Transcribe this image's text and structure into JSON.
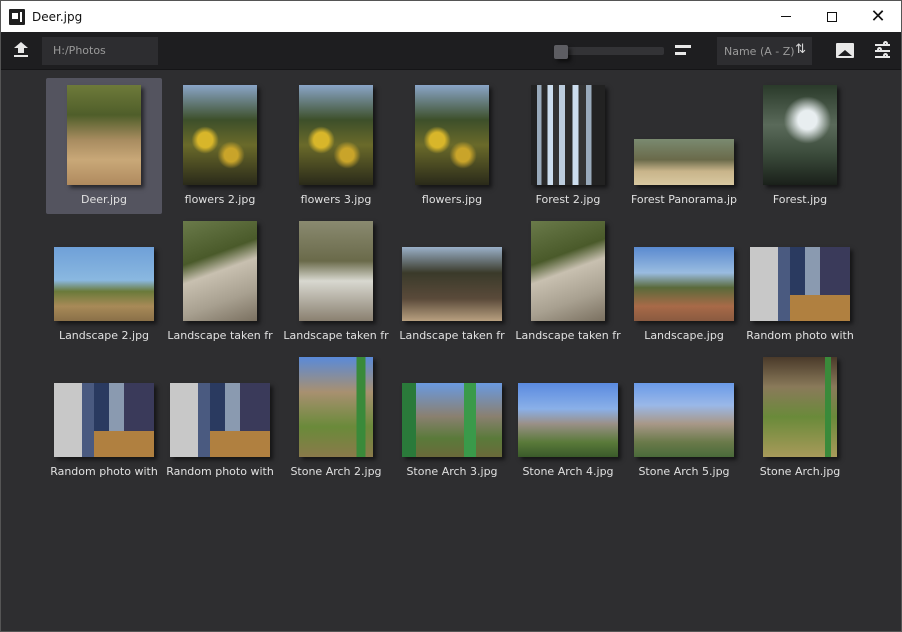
{
  "window": {
    "title": "Deer.jpg",
    "controls": {
      "minimize": "minimize",
      "maximize": "maximize",
      "close": "✕"
    }
  },
  "toolbar": {
    "upload_icon": "upload-icon",
    "path_value": "H:/Photos",
    "zoom_level": 0,
    "view_icon": "list-view-icon",
    "sort_label": "Name (A - Z)",
    "sort_direction_icon": "⇅",
    "image_icon": "image-icon",
    "settings_icon": "sliders-icon"
  },
  "gallery": {
    "selected_index": 0,
    "items": [
      {
        "name": "Deer.jpg",
        "art": "p-deer",
        "orientation": "portrait"
      },
      {
        "name": "flowers 2.jpg",
        "art": "p-flowers",
        "orientation": "portrait"
      },
      {
        "name": "flowers 3.jpg",
        "art": "p-flowers",
        "orientation": "portrait"
      },
      {
        "name": "flowers.jpg",
        "art": "p-flowers",
        "orientation": "portrait"
      },
      {
        "name": "Forest 2.jpg",
        "art": "p-forest2",
        "orientation": "portrait"
      },
      {
        "name": "Forest Panorama.jp",
        "art": "p-panorama",
        "orientation": "panorama"
      },
      {
        "name": "Forest.jpg",
        "art": "p-forest",
        "orientation": "portrait"
      },
      {
        "name": "Landscape 2.jpg",
        "art": "p-land2",
        "orientation": "landscape"
      },
      {
        "name": "Landscape taken fr",
        "art": "p-wall",
        "orientation": "portrait"
      },
      {
        "name": "Landscape taken fr",
        "art": "p-wall2",
        "orientation": "portrait"
      },
      {
        "name": "Landscape taken fr",
        "art": "p-trees",
        "orientation": "landscape"
      },
      {
        "name": "Landscape taken fr",
        "art": "p-wall",
        "orientation": "portrait"
      },
      {
        "name": "Landscape.jpg",
        "art": "p-land",
        "orientation": "landscape"
      },
      {
        "name": "Random photo with",
        "art": "p-random",
        "orientation": "landscape"
      },
      {
        "name": "Random photo with",
        "art": "p-random",
        "orientation": "landscape"
      },
      {
        "name": "Random photo with",
        "art": "p-random",
        "orientation": "landscape"
      },
      {
        "name": "Stone Arch 2.jpg",
        "art": "p-arch2",
        "orientation": "portrait"
      },
      {
        "name": "Stone Arch 3.jpg",
        "art": "p-arch3",
        "orientation": "landscape"
      },
      {
        "name": "Stone Arch 4.jpg",
        "art": "p-arch4",
        "orientation": "landscape"
      },
      {
        "name": "Stone Arch 5.jpg",
        "art": "p-arch5",
        "orientation": "landscape"
      },
      {
        "name": "Stone Arch.jpg",
        "art": "p-arch",
        "orientation": "portrait"
      }
    ]
  }
}
